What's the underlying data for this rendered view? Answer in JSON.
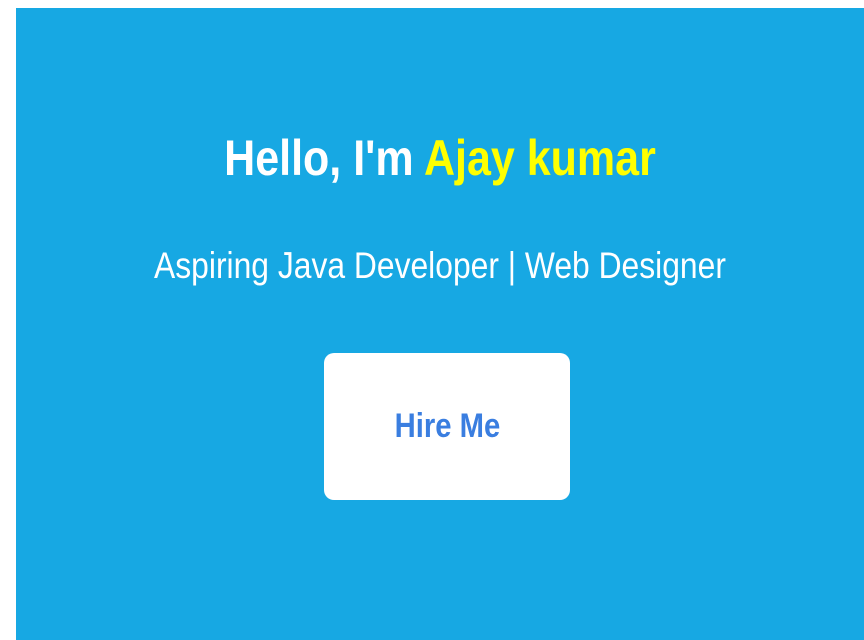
{
  "hero": {
    "greeting": "Hello, I'm ",
    "name": "Ajay kumar",
    "subtitle": "Aspiring Java Developer | Web Designer",
    "button_label": "Hire Me",
    "colors": {
      "background": "#17a8e3",
      "heading": "#ffffff",
      "name_highlight": "#ffff00",
      "button_background": "#ffffff",
      "button_text": "#3a7ee0"
    }
  }
}
